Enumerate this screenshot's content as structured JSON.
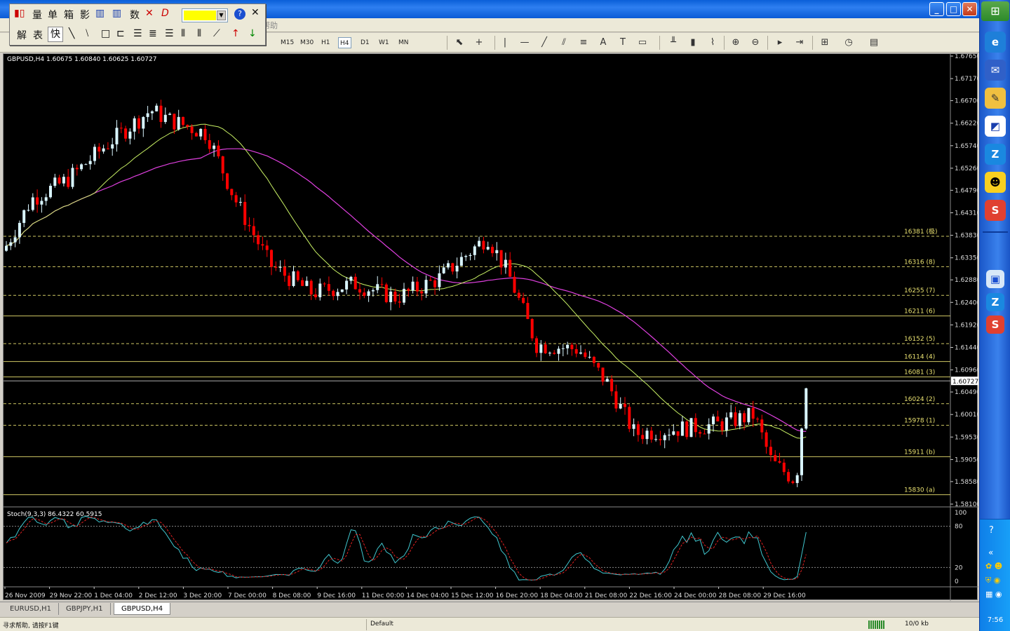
{
  "menu": {
    "help": "帮助"
  },
  "timeframes": [
    {
      "label": "M15"
    },
    {
      "label": "M30"
    },
    {
      "label": "H1"
    },
    {
      "label": "H4"
    },
    {
      "label": "D1"
    },
    {
      "label": "W1"
    },
    {
      "label": "MN"
    }
  ],
  "float_toolbar": {
    "row1": [
      "量",
      "单",
      "箱",
      "影",
      "数"
    ],
    "row2": [
      "解",
      "表",
      "快"
    ],
    "color": "#ffff00"
  },
  "chart": {
    "symbol_info": "GBPUSD,H4  1.60675 1.60840 1.60625 1.60727",
    "current_price": "1.60727",
    "price_axis": [
      "1.67650",
      "1.67170",
      "1.66700",
      "1.66220",
      "1.65740",
      "1.65260",
      "1.64790",
      "1.64310",
      "1.63830",
      "1.63350",
      "1.62880",
      "1.62400",
      "1.61920",
      "1.61440",
      "1.60960",
      "1.60490",
      "1.60010",
      "1.59530",
      "1.59050",
      "1.58580",
      "1.58100"
    ],
    "levels": [
      {
        "label": "16381 (极)",
        "style": "dashed"
      },
      {
        "label": "16316 (8)",
        "style": "dashed"
      },
      {
        "label": "16255 (7)",
        "style": "dashed"
      },
      {
        "label": "16211 (6)",
        "style": "solid"
      },
      {
        "label": "16152 (5)",
        "style": "dashed"
      },
      {
        "label": "16114 (4)",
        "style": "solid"
      },
      {
        "label": "16081 (3)",
        "style": "solid"
      },
      {
        "label": "16024 (2)",
        "style": "dashed"
      },
      {
        "label": "15978 (1)",
        "style": "dashed"
      },
      {
        "label": "15911 (b)",
        "style": "solid"
      },
      {
        "label": "15830 (a)",
        "style": "solid"
      }
    ],
    "time_axis": [
      "26 Nov 2009",
      "29 Nov 22:00",
      "1 Dec 04:00",
      "2 Dec 12:00",
      "3 Dec 20:00",
      "7 Dec 00:00",
      "8 Dec 08:00",
      "9 Dec 16:00",
      "11 Dec 00:00",
      "14 Dec 04:00",
      "15 Dec 12:00",
      "16 Dec 20:00",
      "18 Dec 04:00",
      "21 Dec 08:00",
      "22 Dec 16:00",
      "24 Dec 00:00",
      "28 Dec 08:00",
      "29 Dec 16:00"
    ],
    "colors": {
      "up": "#d9f5ff",
      "down": "#ff0000",
      "ma_fast": "#c8f064",
      "ma_slow": "#e040e0",
      "level": "#e8e070"
    },
    "stoch_info": "Stoch(9,3,3) 86.4322 60.5915",
    "stoch_axis": [
      "100",
      "80",
      "20",
      "0"
    ]
  },
  "tabs": [
    {
      "label": "EURUSD,H1",
      "active": false
    },
    {
      "label": "GBPJPY,H1",
      "active": false
    },
    {
      "label": "GBPUSD,H4",
      "active": true
    }
  ],
  "status": {
    "help": "寻求帮助, 请按F1键",
    "profile": "Default",
    "traffic": "10/0 kb"
  },
  "taskbar": {
    "clock": "7:56"
  }
}
